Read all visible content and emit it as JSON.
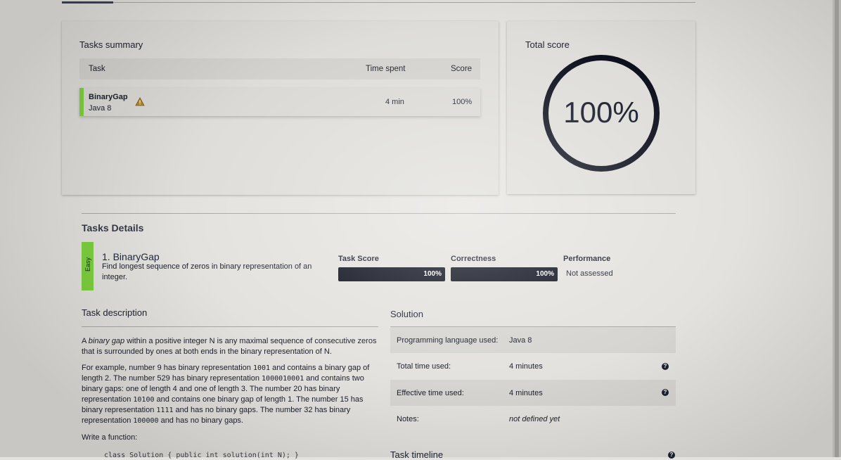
{
  "summary": {
    "title": "Tasks summary",
    "columns": [
      "Task",
      "Time spent",
      "Score"
    ],
    "rows": [
      {
        "task": "BinaryGap",
        "language": "Java 8",
        "time": "4 min",
        "score": "100%",
        "icon": "warning-icon"
      }
    ]
  },
  "total_score": {
    "title": "Total score",
    "value": "100%",
    "fraction": 1.0
  },
  "details": {
    "title": "Tasks Details",
    "difficulty": "Easy",
    "task_title_prefix": "1. ",
    "task_title": "BinaryGap",
    "task_subtitle": "Find longest sequence of zeros in binary representation of an integer.",
    "metrics": {
      "task_score_label": "Task Score",
      "task_score_value": "100%",
      "correctness_label": "Correctness",
      "correctness_value": "100%",
      "performance_label": "Performance",
      "performance_value": "Not assessed"
    }
  },
  "description": {
    "title": "Task description",
    "p1_a": "A ",
    "p1_em": "binary gap",
    "p1_b": " within a positive integer N is any maximal sequence of consecutive zeros that is surrounded by ones at both ends in the binary representation of N.",
    "p2_t1": "For example, number 9 has binary representation ",
    "p2_c1": "1001",
    "p2_t2": " and contains a binary gap of length 2. The number 529 has binary representation ",
    "p2_c2": "1000010001",
    "p2_t3": " and contains two binary gaps: one of length 4 and one of length 3. The number 20 has binary representation ",
    "p2_c3": "10100",
    "p2_t4": " and contains one binary gap of length 1. The number 15 has binary representation ",
    "p2_c4": "1111",
    "p2_t5": " and has no binary gaps. The number 32 has binary representation ",
    "p2_c5": "100000",
    "p2_t6": " and has no binary gaps.",
    "p3": "Write a function:",
    "code": "class Solution { public int solution(int N); }"
  },
  "solution": {
    "title": "Solution",
    "rows": [
      {
        "key": "Programming language used:",
        "value": "Java 8"
      },
      {
        "key": "Total time used:",
        "value": "4 minutes"
      },
      {
        "key": "Effective time used:",
        "value": "4 minutes"
      },
      {
        "key": "Notes:",
        "value": "not defined yet"
      }
    ],
    "timeline_title": "Task timeline"
  }
}
